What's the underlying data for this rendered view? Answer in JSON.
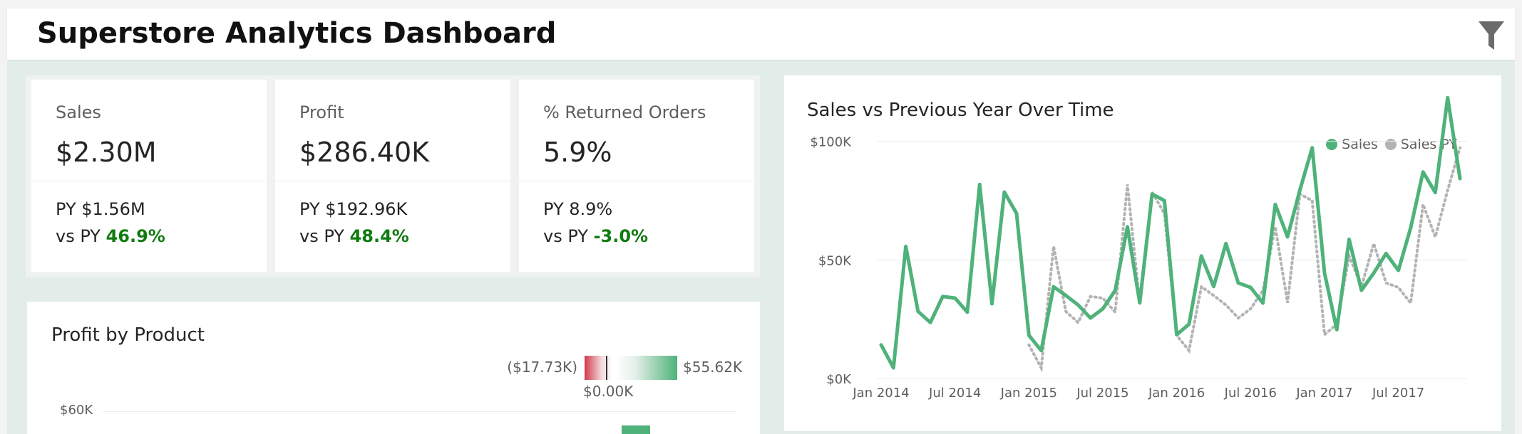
{
  "header": {
    "title": "Superstore Analytics Dashboard",
    "filter_icon": "filter-icon"
  },
  "kpis": [
    {
      "label": "Sales",
      "value": "$2.30M",
      "py": "PY $1.56M",
      "vs_prefix": "vs PY ",
      "vs_value": "46.9%"
    },
    {
      "label": "Profit",
      "value": "$286.40K",
      "py": "PY $192.96K",
      "vs_prefix": "vs PY ",
      "vs_value": "48.4%"
    },
    {
      "label": "% Returned Orders",
      "value": "5.9%",
      "py": "PY 8.9%",
      "vs_prefix": "vs PY ",
      "vs_value": "-3.0%"
    }
  ],
  "profit_panel": {
    "title": "Profit by Product",
    "legend_min": "($17.73K)",
    "legend_mid": "$0.00K",
    "legend_max": "$55.62K",
    "y_tick_top": "$60K"
  },
  "colors": {
    "sales": "#4fb27a",
    "sales_py": "#b3b3b3",
    "positive": "#107c10",
    "negative": "#d13a4a"
  },
  "chart_data": {
    "type": "line",
    "title": "Sales vs Previous Year Over Time",
    "xlabel": "",
    "ylabel": "",
    "x_tick_labels": [
      "Jan 2014",
      "Jul 2014",
      "Jan 2015",
      "Jul 2015",
      "Jan 2016",
      "Jul 2016",
      "Jan 2017",
      "Jul 2017"
    ],
    "y_tick_labels": [
      "$0K",
      "$50K",
      "$100K"
    ],
    "ylim": [
      0,
      120000
    ],
    "legend_position": "top-right",
    "grid": true,
    "x": [
      "2014-01",
      "2014-02",
      "2014-03",
      "2014-04",
      "2014-05",
      "2014-06",
      "2014-07",
      "2014-08",
      "2014-09",
      "2014-10",
      "2014-11",
      "2014-12",
      "2015-01",
      "2015-02",
      "2015-03",
      "2015-04",
      "2015-05",
      "2015-06",
      "2015-07",
      "2015-08",
      "2015-09",
      "2015-10",
      "2015-11",
      "2015-12",
      "2016-01",
      "2016-02",
      "2016-03",
      "2016-04",
      "2016-05",
      "2016-06",
      "2016-07",
      "2016-08",
      "2016-09",
      "2016-10",
      "2016-11",
      "2016-12",
      "2017-01",
      "2017-02",
      "2017-03",
      "2017-04",
      "2017-05",
      "2017-06",
      "2017-07",
      "2017-08",
      "2017-09",
      "2017-10",
      "2017-11",
      "2017-12"
    ],
    "series": [
      {
        "name": "Sales",
        "values": [
          14200,
          4500,
          55700,
          28300,
          23600,
          34600,
          33900,
          28000,
          81800,
          31500,
          78600,
          69600,
          18200,
          11800,
          38700,
          35000,
          31000,
          25500,
          29400,
          37100,
          64000,
          31900,
          77800,
          75000,
          18500,
          22900,
          51700,
          38800,
          56900,
          40300,
          38400,
          31800,
          73400,
          59700,
          79400,
          97300,
          44500,
          20600,
          58700,
          37200,
          44500,
          52700,
          45600,
          63600,
          87100,
          78400,
          118400,
          84300
        ]
      },
      {
        "name": "Sales PY",
        "values": [
          null,
          null,
          null,
          null,
          null,
          null,
          null,
          null,
          null,
          null,
          null,
          null,
          14200,
          4500,
          55700,
          28300,
          23600,
          34600,
          33900,
          28000,
          81800,
          31500,
          78600,
          69600,
          18200,
          11800,
          38700,
          35000,
          31000,
          25500,
          29400,
          37100,
          64000,
          31900,
          77800,
          75000,
          18500,
          22900,
          51700,
          38800,
          56900,
          40300,
          38400,
          31800,
          73400,
          59700,
          79400,
          97300
        ]
      }
    ]
  }
}
